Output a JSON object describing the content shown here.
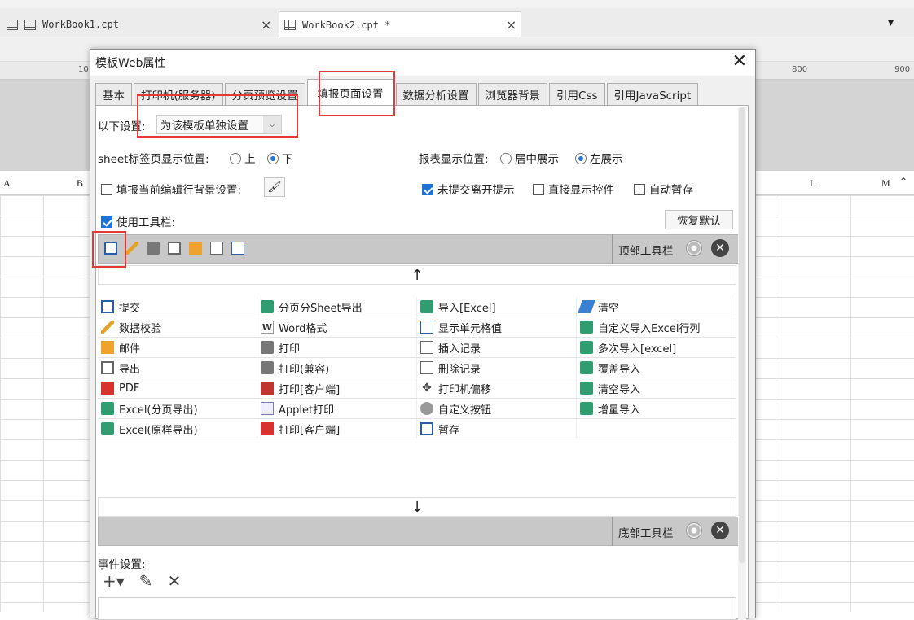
{
  "file_tabs": [
    {
      "label": "WorkBook1.cpt"
    },
    {
      "label": "WorkBook2.cpt *"
    }
  ],
  "ruler": {
    "labels": [
      "10",
      "800",
      "900"
    ]
  },
  "columns": {
    "a": "A",
    "b": "B",
    "l": "L",
    "m": "M"
  },
  "dialog": {
    "title": "模板Web属性",
    "tabs": [
      "基本",
      "打印机(服务器)",
      "分页预览设置",
      "填报页面设置",
      "数据分析设置",
      "浏览器背景",
      "引用Css",
      "引用JavaScript"
    ],
    "settings_label": "以下设置:",
    "settings_value": "为该模板单独设置",
    "sheet_tab_label": "sheet标签页显示位置:",
    "sheet_tab_options": [
      "上",
      "下"
    ],
    "report_pos_label": "报表显示位置:",
    "report_pos_options": [
      "居中展示",
      "左展示"
    ],
    "fill_bg_label": "填报当前编辑行背景设置:",
    "unsubmitted_label": "未提交离开提示",
    "direct_show_label": "直接显示控件",
    "autosave_label": "自动暂存",
    "use_toolbar_label": "使用工具栏:",
    "restore_default": "恢复默认",
    "top_toolbar_label": "顶部工具栏",
    "bottom_toolbar_label": "底部工具栏",
    "buttons": [
      [
        "提交",
        "分页分Sheet导出",
        "导入[Excel]",
        "清空"
      ],
      [
        "数据校验",
        "Word格式",
        "显示单元格值",
        "自定义导入Excel行列"
      ],
      [
        "邮件",
        "打印",
        "插入记录",
        "多次导入[excel]"
      ],
      [
        "导出",
        "打印(兼容)",
        "删除记录",
        "覆盖导入"
      ],
      [
        "PDF",
        "打印[客户端]",
        "打印机偏移",
        "清空导入"
      ],
      [
        "Excel(分页导出)",
        "Applet打印",
        "自定义按钮",
        "增量导入"
      ],
      [
        "Excel(原样导出)",
        "打印[客户端]",
        "暂存",
        ""
      ]
    ],
    "event_label": "事件设置:"
  }
}
